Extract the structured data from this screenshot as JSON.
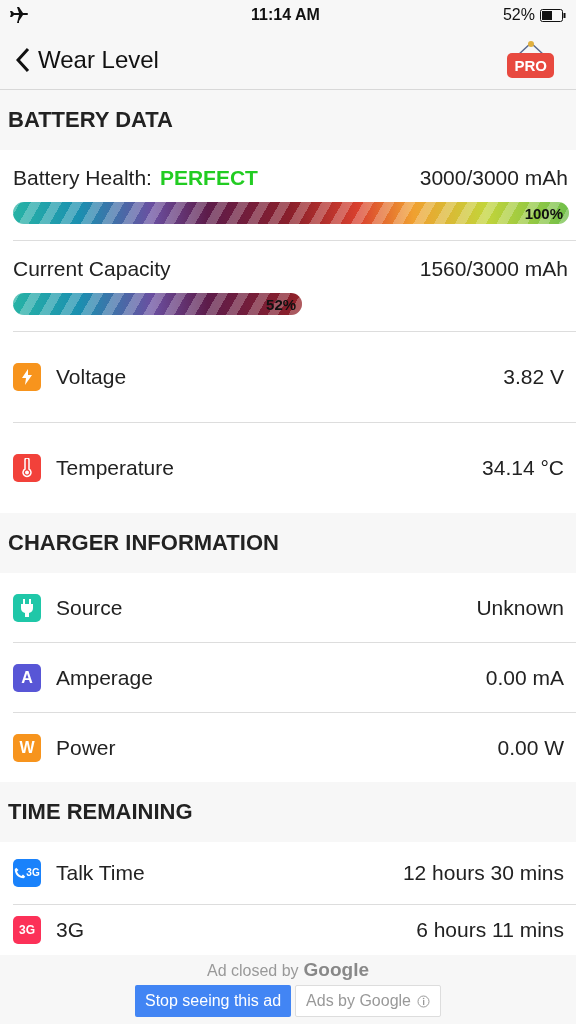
{
  "status_bar": {
    "time": "11:14 AM",
    "battery": "52%"
  },
  "nav": {
    "back_label": "Wear Level",
    "pro_badge": "PRO"
  },
  "sections": [
    {
      "title": "BATTERY DATA",
      "meters": [
        {
          "label": "Battery Health:",
          "status": "PERFECT",
          "reading": "3000/3000 mAh",
          "percent": "100%"
        },
        {
          "label": "Current Capacity",
          "reading": "1560/3000 mAh",
          "percent": "52%"
        }
      ],
      "rows": [
        {
          "kind": "bolt",
          "color": "#f7941d",
          "label": "Voltage",
          "value": "3.82 V"
        },
        {
          "kind": "thermometer",
          "color": "#f2413a",
          "label": "Temperature",
          "value": "34.14 °C"
        }
      ]
    },
    {
      "title": "CHARGER INFORMATION",
      "rows": [
        {
          "kind": "plug",
          "color": "#1fc7a8",
          "label": "Source",
          "value": "Unknown"
        },
        {
          "kind": "letter",
          "badge": "A",
          "color": "#5856d6",
          "label": "Amperage",
          "value": "0.00 mA"
        },
        {
          "kind": "letter",
          "badge": "W",
          "color": "#f7941d",
          "label": "Power",
          "value": "0.00 W"
        }
      ]
    },
    {
      "title": "TIME REMAINING",
      "rows": [
        {
          "kind": "phone",
          "badge": "3G",
          "color": "#1a82fb",
          "label": "Talk Time",
          "value": "12 hours 30 mins"
        },
        {
          "kind": "letter",
          "badge": "3G",
          "color": "#fc3158",
          "label": "3G",
          "value": "6 hours 11 mins"
        }
      ]
    }
  ],
  "ad": {
    "closed_text": "Ad closed by",
    "brand": "Google",
    "stop_button": "Stop seeing this ad",
    "ads_by": "Ads by Google"
  }
}
